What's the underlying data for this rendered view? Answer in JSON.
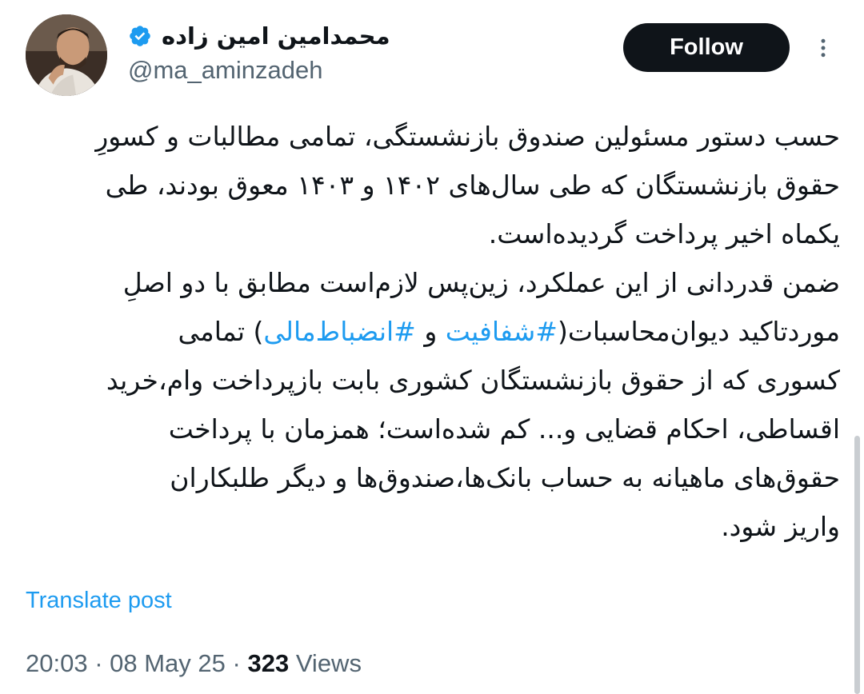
{
  "author": {
    "display_name": "محمدامین امین زاده",
    "handle": "@ma_aminzadeh",
    "verified": true
  },
  "actions": {
    "follow_label": "Follow"
  },
  "post": {
    "lines": [
      "حسب دستور مسئولین صندوق بازنشستگی، تمامی مطالبات و کسورِ",
      "حقوق بازنشستگان که طی سال‌های ۱۴۰۲ و ۱۴۰۳ معوق بودند، طی",
      "یکماه اخیر پرداخت گردیده‌است.",
      "ضمن قدردانی از این عملکرد، زین‌پس لازم‌است مطابق با دو اصلِ"
    ],
    "line5_before": "موردتاکید دیوان‌محاسبات(",
    "hashtag_1": "#شفافیت",
    "line5_and": " و ",
    "hashtag_2": "#انضباط‌مالی",
    "line5_after": ") تمامی",
    "lines_after": [
      "کسوری که از حقوق بازنشستگان کشوری بابت بازپرداخت وام،خرید",
      "اقساطی، احکام قضایی و... کم شده‌است؛ همزمان با پرداخت",
      "حقوق‌های ماهیانه به حساب بانک‌ها،صندوق‌ها و دیگر طلبکاران",
      "واریز شود."
    ]
  },
  "translate_label": "Translate post",
  "meta": {
    "time": "20:03",
    "separator": " · ",
    "date": "08 May 25",
    "views_count": "323",
    "views_label": " Views"
  },
  "colors": {
    "link": "#1d9bf0",
    "text": "#0f1419",
    "secondary": "#536471",
    "follow_bg": "#0f1419"
  },
  "icons": {
    "verified": "verified-badge-icon",
    "more": "more-vertical-icon"
  }
}
